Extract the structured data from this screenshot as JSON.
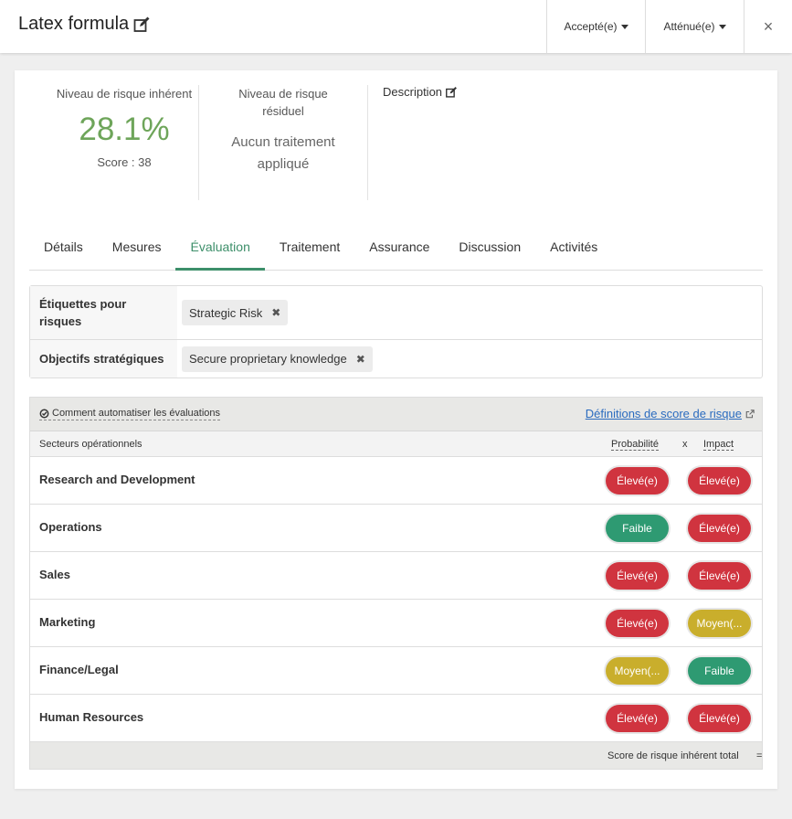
{
  "header": {
    "title": "Latex formula",
    "accepted_label": "Accepté(e)",
    "mitigated_label": "Atténué(e)",
    "close_glyph": "×"
  },
  "risk": {
    "inherent_label": "Niveau de risque inhérent",
    "inherent_value": "28.1%",
    "inherent_score": "Score : 38",
    "residual_label": "Niveau de risque résiduel",
    "residual_value": "Aucun traitement appliqué",
    "description_label": "Description",
    "inherent_color": "#6ea55a"
  },
  "tabs": [
    {
      "label": "Détails"
    },
    {
      "label": "Mesures"
    },
    {
      "label": "Évaluation",
      "active": true
    },
    {
      "label": "Traitement"
    },
    {
      "label": "Assurance"
    },
    {
      "label": "Discussion"
    },
    {
      "label": "Activités"
    }
  ],
  "tags": {
    "risk_tags_label": "Étiquettes pour risques",
    "risk_tags": [
      "Strategic Risk"
    ],
    "objectives_label": "Objectifs stratégiques",
    "objectives": [
      "Secure proprietary knowledge"
    ]
  },
  "assessment": {
    "auto_link": "Comment automatiser les évaluations",
    "definitions_link": "Définitions de score de risque",
    "col_sectors": "Secteurs opérationnels",
    "col_probability": "Probabilité",
    "col_x": "x",
    "col_impact": "Impact",
    "rows": [
      {
        "name": "Research and Development",
        "prob": "Élevé(e)",
        "prob_color": "#d0343f",
        "impact": "Élevé(e)",
        "impact_color": "#d0343f"
      },
      {
        "name": "Operations",
        "prob": "Faible",
        "prob_color": "#2e9a72",
        "impact": "Élevé(e)",
        "impact_color": "#d0343f"
      },
      {
        "name": "Sales",
        "prob": "Élevé(e)",
        "prob_color": "#d0343f",
        "impact": "Élevé(e)",
        "impact_color": "#d0343f"
      },
      {
        "name": "Marketing",
        "prob": "Élevé(e)",
        "prob_color": "#d0343f",
        "impact": "Moyen(...",
        "impact_color": "#c9ae2c"
      },
      {
        "name": "Finance/Legal",
        "prob": "Moyen(...",
        "prob_color": "#c9ae2c",
        "impact": "Faible",
        "impact_color": "#2e9a72"
      },
      {
        "name": "Human Resources",
        "prob": "Élevé(e)",
        "prob_color": "#d0343f",
        "impact": "Élevé(e)",
        "impact_color": "#d0343f"
      }
    ],
    "footer_label": "Score de risque inhérent total",
    "footer_eq": "="
  }
}
